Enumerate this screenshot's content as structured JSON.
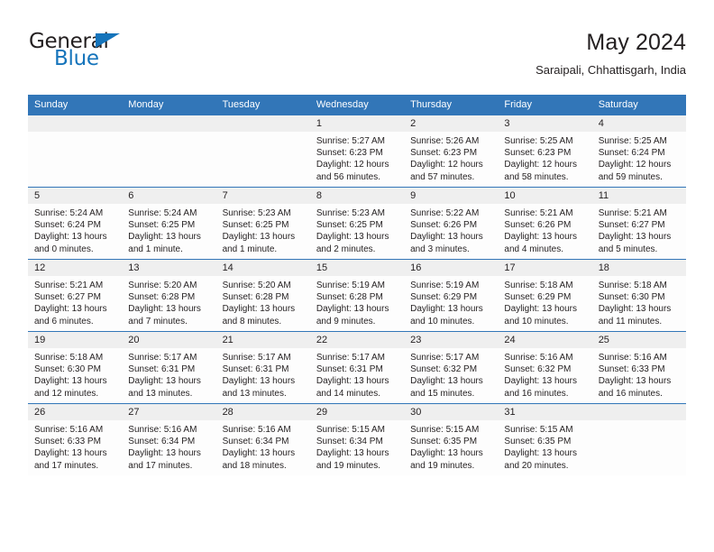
{
  "brand": {
    "word_one": "General",
    "word_two": "Blue",
    "triangle_icon": "triangle-icon"
  },
  "header": {
    "title": "May 2024",
    "subtitle": "Saraipali, Chhattisgarh, India"
  },
  "colors": {
    "header_blue": "#3276b8",
    "brand_blue": "#1574bb",
    "daynum_band": "#efefef",
    "text": "#231f20"
  },
  "weekday_headers": [
    "Sunday",
    "Monday",
    "Tuesday",
    "Wednesday",
    "Thursday",
    "Friday",
    "Saturday"
  ],
  "labels": {
    "sunrise_prefix": "Sunrise:",
    "sunset_prefix": "Sunset:",
    "daylight_prefix": "Daylight:"
  },
  "weeks": [
    [
      {
        "day": "",
        "empty": true
      },
      {
        "day": "",
        "empty": true
      },
      {
        "day": "",
        "empty": true
      },
      {
        "day": "1",
        "sunrise": "Sunrise: 5:27 AM",
        "sunset": "Sunset: 6:23 PM",
        "daylight_1": "Daylight: 12 hours",
        "daylight_2": "and 56 minutes."
      },
      {
        "day": "2",
        "sunrise": "Sunrise: 5:26 AM",
        "sunset": "Sunset: 6:23 PM",
        "daylight_1": "Daylight: 12 hours",
        "daylight_2": "and 57 minutes."
      },
      {
        "day": "3",
        "sunrise": "Sunrise: 5:25 AM",
        "sunset": "Sunset: 6:23 PM",
        "daylight_1": "Daylight: 12 hours",
        "daylight_2": "and 58 minutes."
      },
      {
        "day": "4",
        "sunrise": "Sunrise: 5:25 AM",
        "sunset": "Sunset: 6:24 PM",
        "daylight_1": "Daylight: 12 hours",
        "daylight_2": "and 59 minutes."
      }
    ],
    [
      {
        "day": "5",
        "sunrise": "Sunrise: 5:24 AM",
        "sunset": "Sunset: 6:24 PM",
        "daylight_1": "Daylight: 13 hours",
        "daylight_2": "and 0 minutes."
      },
      {
        "day": "6",
        "sunrise": "Sunrise: 5:24 AM",
        "sunset": "Sunset: 6:25 PM",
        "daylight_1": "Daylight: 13 hours",
        "daylight_2": "and 1 minute."
      },
      {
        "day": "7",
        "sunrise": "Sunrise: 5:23 AM",
        "sunset": "Sunset: 6:25 PM",
        "daylight_1": "Daylight: 13 hours",
        "daylight_2": "and 1 minute."
      },
      {
        "day": "8",
        "sunrise": "Sunrise: 5:23 AM",
        "sunset": "Sunset: 6:25 PM",
        "daylight_1": "Daylight: 13 hours",
        "daylight_2": "and 2 minutes."
      },
      {
        "day": "9",
        "sunrise": "Sunrise: 5:22 AM",
        "sunset": "Sunset: 6:26 PM",
        "daylight_1": "Daylight: 13 hours",
        "daylight_2": "and 3 minutes."
      },
      {
        "day": "10",
        "sunrise": "Sunrise: 5:21 AM",
        "sunset": "Sunset: 6:26 PM",
        "daylight_1": "Daylight: 13 hours",
        "daylight_2": "and 4 minutes."
      },
      {
        "day": "11",
        "sunrise": "Sunrise: 5:21 AM",
        "sunset": "Sunset: 6:27 PM",
        "daylight_1": "Daylight: 13 hours",
        "daylight_2": "and 5 minutes."
      }
    ],
    [
      {
        "day": "12",
        "sunrise": "Sunrise: 5:21 AM",
        "sunset": "Sunset: 6:27 PM",
        "daylight_1": "Daylight: 13 hours",
        "daylight_2": "and 6 minutes."
      },
      {
        "day": "13",
        "sunrise": "Sunrise: 5:20 AM",
        "sunset": "Sunset: 6:28 PM",
        "daylight_1": "Daylight: 13 hours",
        "daylight_2": "and 7 minutes."
      },
      {
        "day": "14",
        "sunrise": "Sunrise: 5:20 AM",
        "sunset": "Sunset: 6:28 PM",
        "daylight_1": "Daylight: 13 hours",
        "daylight_2": "and 8 minutes."
      },
      {
        "day": "15",
        "sunrise": "Sunrise: 5:19 AM",
        "sunset": "Sunset: 6:28 PM",
        "daylight_1": "Daylight: 13 hours",
        "daylight_2": "and 9 minutes."
      },
      {
        "day": "16",
        "sunrise": "Sunrise: 5:19 AM",
        "sunset": "Sunset: 6:29 PM",
        "daylight_1": "Daylight: 13 hours",
        "daylight_2": "and 10 minutes."
      },
      {
        "day": "17",
        "sunrise": "Sunrise: 5:18 AM",
        "sunset": "Sunset: 6:29 PM",
        "daylight_1": "Daylight: 13 hours",
        "daylight_2": "and 10 minutes."
      },
      {
        "day": "18",
        "sunrise": "Sunrise: 5:18 AM",
        "sunset": "Sunset: 6:30 PM",
        "daylight_1": "Daylight: 13 hours",
        "daylight_2": "and 11 minutes."
      }
    ],
    [
      {
        "day": "19",
        "sunrise": "Sunrise: 5:18 AM",
        "sunset": "Sunset: 6:30 PM",
        "daylight_1": "Daylight: 13 hours",
        "daylight_2": "and 12 minutes."
      },
      {
        "day": "20",
        "sunrise": "Sunrise: 5:17 AM",
        "sunset": "Sunset: 6:31 PM",
        "daylight_1": "Daylight: 13 hours",
        "daylight_2": "and 13 minutes."
      },
      {
        "day": "21",
        "sunrise": "Sunrise: 5:17 AM",
        "sunset": "Sunset: 6:31 PM",
        "daylight_1": "Daylight: 13 hours",
        "daylight_2": "and 13 minutes."
      },
      {
        "day": "22",
        "sunrise": "Sunrise: 5:17 AM",
        "sunset": "Sunset: 6:31 PM",
        "daylight_1": "Daylight: 13 hours",
        "daylight_2": "and 14 minutes."
      },
      {
        "day": "23",
        "sunrise": "Sunrise: 5:17 AM",
        "sunset": "Sunset: 6:32 PM",
        "daylight_1": "Daylight: 13 hours",
        "daylight_2": "and 15 minutes."
      },
      {
        "day": "24",
        "sunrise": "Sunrise: 5:16 AM",
        "sunset": "Sunset: 6:32 PM",
        "daylight_1": "Daylight: 13 hours",
        "daylight_2": "and 16 minutes."
      },
      {
        "day": "25",
        "sunrise": "Sunrise: 5:16 AM",
        "sunset": "Sunset: 6:33 PM",
        "daylight_1": "Daylight: 13 hours",
        "daylight_2": "and 16 minutes."
      }
    ],
    [
      {
        "day": "26",
        "sunrise": "Sunrise: 5:16 AM",
        "sunset": "Sunset: 6:33 PM",
        "daylight_1": "Daylight: 13 hours",
        "daylight_2": "and 17 minutes."
      },
      {
        "day": "27",
        "sunrise": "Sunrise: 5:16 AM",
        "sunset": "Sunset: 6:34 PM",
        "daylight_1": "Daylight: 13 hours",
        "daylight_2": "and 17 minutes."
      },
      {
        "day": "28",
        "sunrise": "Sunrise: 5:16 AM",
        "sunset": "Sunset: 6:34 PM",
        "daylight_1": "Daylight: 13 hours",
        "daylight_2": "and 18 minutes."
      },
      {
        "day": "29",
        "sunrise": "Sunrise: 5:15 AM",
        "sunset": "Sunset: 6:34 PM",
        "daylight_1": "Daylight: 13 hours",
        "daylight_2": "and 19 minutes."
      },
      {
        "day": "30",
        "sunrise": "Sunrise: 5:15 AM",
        "sunset": "Sunset: 6:35 PM",
        "daylight_1": "Daylight: 13 hours",
        "daylight_2": "and 19 minutes."
      },
      {
        "day": "31",
        "sunrise": "Sunrise: 5:15 AM",
        "sunset": "Sunset: 6:35 PM",
        "daylight_1": "Daylight: 13 hours",
        "daylight_2": "and 20 minutes."
      },
      {
        "day": "",
        "empty": true
      }
    ]
  ]
}
